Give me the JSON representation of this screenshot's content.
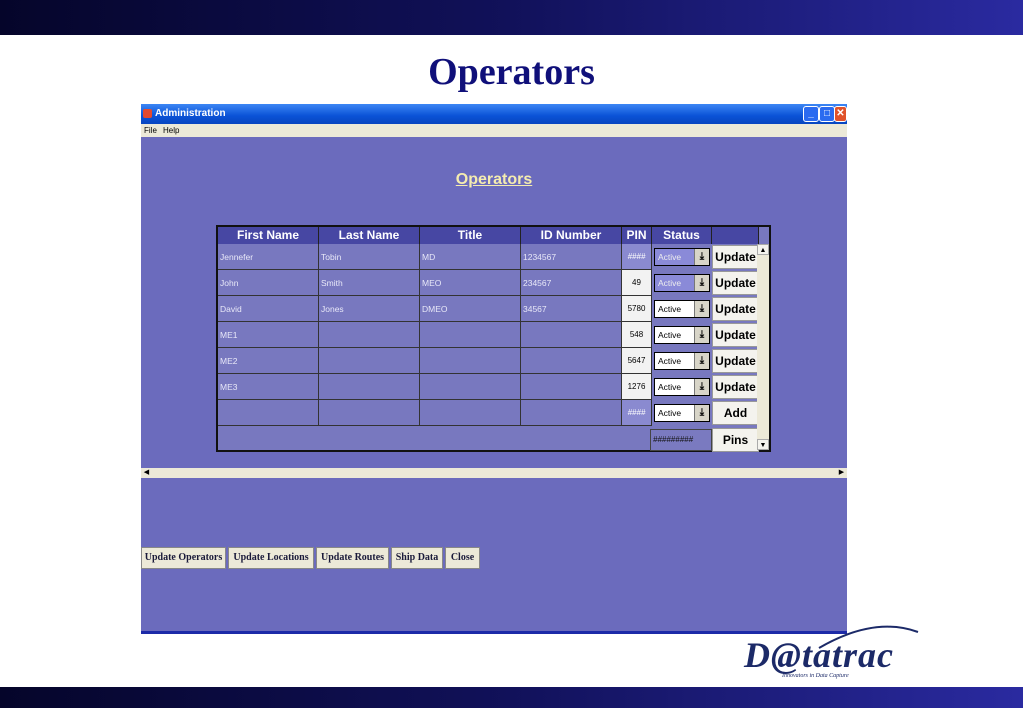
{
  "slide": {
    "title": "Operators"
  },
  "window": {
    "title": "Administration"
  },
  "menu": {
    "items": [
      "File",
      "Help"
    ]
  },
  "main": {
    "heading": "Operators"
  },
  "table": {
    "headers": [
      "First Name",
      "Last Name",
      "Title",
      "ID Number",
      "PIN",
      "Status"
    ],
    "rows": [
      {
        "first": "Jennefer",
        "last": "Tobin",
        "title": "MD",
        "id": "1234567",
        "pin": "####",
        "status": "Active",
        "action": "Update"
      },
      {
        "first": "John",
        "last": "Smith",
        "title": "MEO",
        "id": "234567",
        "pin": "49",
        "status": "Active",
        "action": "Update"
      },
      {
        "first": "David",
        "last": "Jones",
        "title": "DMEO",
        "id": "34567",
        "pin": "5780",
        "status": "Active",
        "action": "Update"
      },
      {
        "first": "ME1",
        "last": "",
        "title": "",
        "id": "",
        "pin": "548",
        "status": "Active",
        "action": "Update"
      },
      {
        "first": "ME2",
        "last": "",
        "title": "",
        "id": "",
        "pin": "5647",
        "status": "Active",
        "action": "Update"
      },
      {
        "first": "ME3",
        "last": "",
        "title": "",
        "id": "",
        "pin": "1276",
        "status": "Active",
        "action": "Update"
      },
      {
        "first": "",
        "last": "",
        "title": "",
        "id": "",
        "pin": "####",
        "status": "Active",
        "action": "Add"
      }
    ],
    "pins_value": "#########",
    "pins_button": "Pins"
  },
  "bottom_buttons": [
    "Update Operators",
    "Update Locations",
    "Update Routes",
    "Ship Data",
    "Close"
  ],
  "logo": {
    "name": "D@tatrac",
    "tagline": "Innovators in Data Capture"
  },
  "icons": {
    "dropdown": "⤓",
    "scroll_up": "▲",
    "scroll_down": "▼",
    "scroll_left": "◀",
    "scroll_right": "▶"
  }
}
